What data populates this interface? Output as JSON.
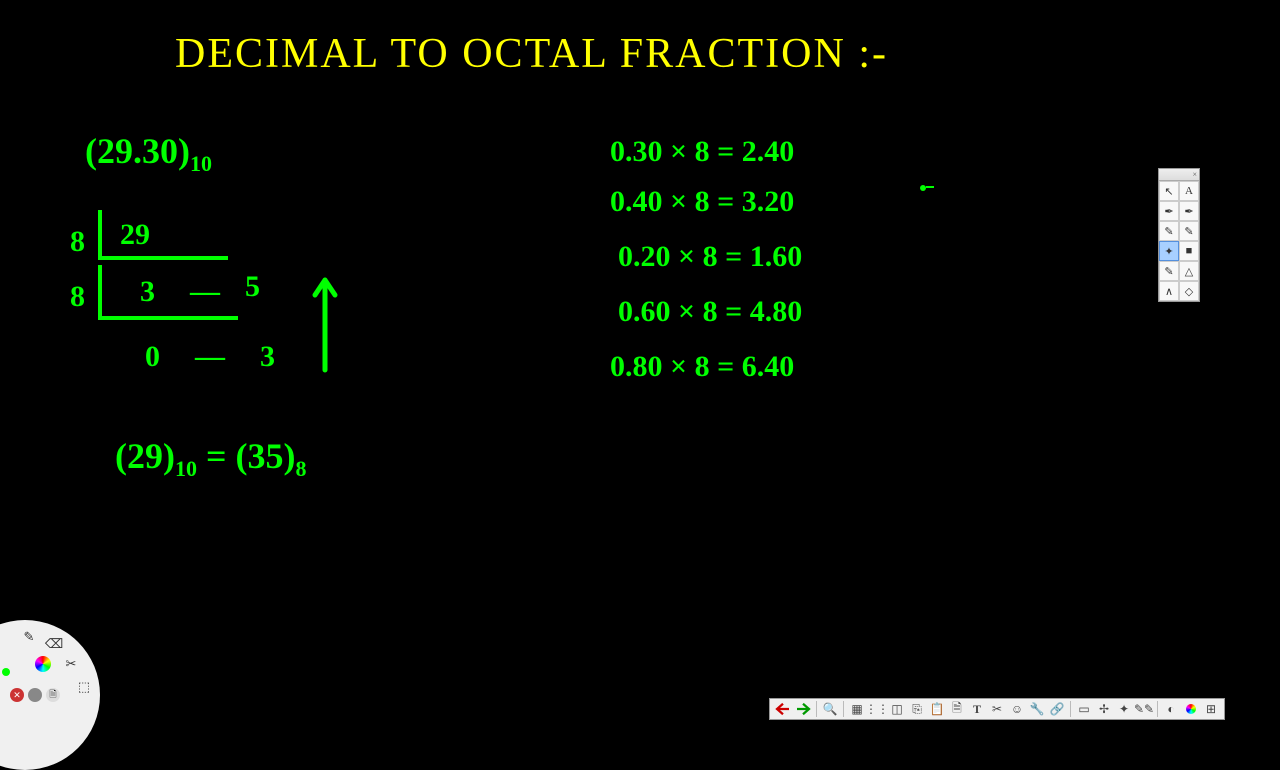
{
  "title": "DECIMAL TO OCTAL FRACTION :-",
  "problem": {
    "input_number": "(29.30)",
    "input_base": "10"
  },
  "integer_division": {
    "divisor1": "8",
    "dividend": "29",
    "divisor2": "8",
    "quotient1": "3",
    "dash1": "—",
    "remainder1": "5",
    "quotient2": "0",
    "dash2": "—",
    "remainder2": "3"
  },
  "integer_result": {
    "lhs_num": "(29)",
    "lhs_base": "10",
    "eq": " = ",
    "rhs_num": "(35)",
    "rhs_base": "8"
  },
  "fraction_steps": [
    "0.30 × 8  =  2.40",
    "0.40 × 8  = 3.20",
    "0.20 × 8  = 1.60",
    "0.60 × 8  =  4.80",
    "0.80 × 8  = 6.40"
  ],
  "right_toolbar": {
    "tools": [
      {
        "a": "↖",
        "b": "A"
      },
      {
        "a": "✒",
        "b": "✒"
      },
      {
        "a": "✎",
        "b": "✎"
      },
      {
        "a": "✦",
        "b": "■"
      },
      {
        "a": "✎",
        "b": "△"
      },
      {
        "a": "∧",
        "b": "◇"
      }
    ],
    "selected_index": 3
  },
  "bottom_toolbar": {
    "items": [
      "undo",
      "redo",
      "sep",
      "zoom",
      "sep",
      "grid",
      "dots",
      "crop",
      "copy",
      "paste",
      "doc",
      "T",
      "scissors",
      "smile",
      "wrench",
      "link",
      "sep",
      "shapes",
      "arrows",
      "sparkle",
      "pens",
      "sep",
      "contrast",
      "rainbow",
      "grid2"
    ]
  },
  "radial": {
    "tools": [
      "✎",
      "⌫",
      "✂",
      "⬚"
    ]
  }
}
